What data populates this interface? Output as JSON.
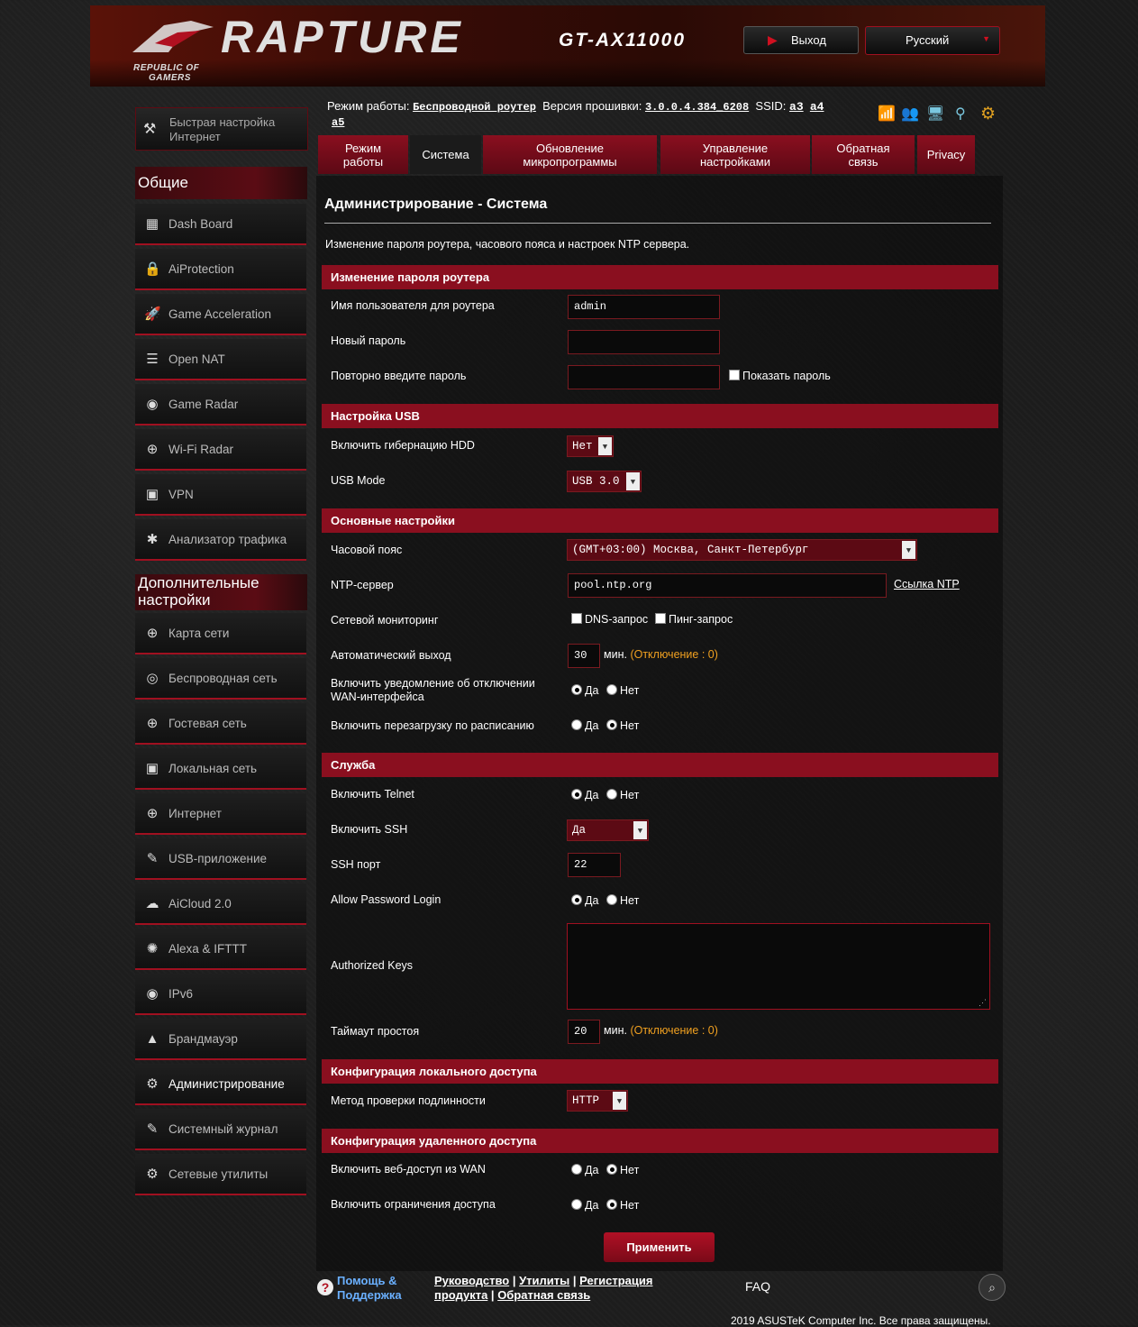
{
  "header": {
    "logo_line1": "REPUBLIC OF",
    "logo_line2": "GAMERS",
    "brand": "RAPTURE",
    "model": "GT-AX11000",
    "logout_label": "Выход",
    "language": "Русский"
  },
  "status": {
    "mode_label": "Режим работы:",
    "mode_value": "Беспроводной роутер",
    "fw_label": "Версия прошивки:",
    "fw_value": "3.0.0.4.384_6208",
    "ssid_label": "SSID:",
    "ssid1": "a3",
    "ssid2": "a4",
    "ssid3": "a5"
  },
  "sidebar": {
    "quick_setup": "Быстрая настройка Интернет",
    "general_title": "Общие",
    "general": [
      {
        "label": "Dash Board",
        "icon": "▦"
      },
      {
        "label": "AiProtection",
        "icon": "🔒"
      },
      {
        "label": "Game Acceleration",
        "icon": "🚀"
      },
      {
        "label": "Open NAT",
        "icon": "☰"
      },
      {
        "label": "Game Radar",
        "icon": "◉"
      },
      {
        "label": "Wi-Fi Radar",
        "icon": "⊕"
      },
      {
        "label": "VPN",
        "icon": "▣"
      },
      {
        "label": "Анализатор трафика",
        "icon": "✱"
      }
    ],
    "advanced_title": "Дополнительные настройки",
    "advanced": [
      {
        "label": "Карта сети",
        "icon": "⊕"
      },
      {
        "label": "Беспроводная сеть",
        "icon": "◎"
      },
      {
        "label": "Гостевая сеть",
        "icon": "⊕"
      },
      {
        "label": "Локальная сеть",
        "icon": "▣"
      },
      {
        "label": "Интернет",
        "icon": "⊕"
      },
      {
        "label": "USB-приложение",
        "icon": "✎"
      },
      {
        "label": "AiCloud 2.0",
        "icon": "☁"
      },
      {
        "label": "Alexa & IFTTT",
        "icon": "✺"
      },
      {
        "label": "IPv6",
        "icon": "◉"
      },
      {
        "label": "Брандмауэр",
        "icon": "▲"
      },
      {
        "label": "Администрирование",
        "icon": "⚙"
      },
      {
        "label": "Системный журнал",
        "icon": "✎"
      },
      {
        "label": "Сетевые утилиты",
        "icon": "⚙"
      }
    ]
  },
  "tabs": [
    {
      "label": "Режим работы"
    },
    {
      "label": "Система"
    },
    {
      "label": "Обновление микропрограммы"
    },
    {
      "label": "Управление настройками"
    },
    {
      "label": "Обратная связь"
    },
    {
      "label": "Privacy"
    }
  ],
  "page": {
    "title": "Администрирование - Система",
    "description": "Изменение пароля роутера, часового пояса и настроек NTP сервера."
  },
  "sections": {
    "password": "Изменение пароля роутера",
    "usb": "Настройка USB",
    "basic": "Основные настройки",
    "service": "Служба",
    "local_access": "Конфигурация локального доступа",
    "remote_access": "Конфигурация удаленного доступа"
  },
  "form": {
    "username_label": "Имя пользователя для роутера",
    "username_value": "admin",
    "new_password_label": "Новый пароль",
    "retype_password_label": "Повторно введите пароль",
    "show_password_label": "Показать пароль",
    "hdd_hibernation_label": "Включить гибернацию HDD",
    "hdd_hibernation_value": "Нет",
    "usb_mode_label": "USB Mode",
    "usb_mode_value": "USB 3.0",
    "timezone_label": "Часовой пояс",
    "timezone_value": "(GMT+03:00) Москва, Санкт-Петербург",
    "ntp_label": "NTP-сервер",
    "ntp_value": "pool.ntp.org",
    "ntp_link": "Ссылка NTP",
    "monitoring_label": "Сетевой мониторинг",
    "dns_query": "DNS-запрос",
    "ping_query": "Пинг-запрос",
    "autologout_label": "Автоматический выход",
    "autologout_value": "30",
    "minutes": "мин.",
    "disable_hint": "(Отключение : 0)",
    "wan_notify_label": "Включить уведомление об отключении WAN-интерфейса",
    "reboot_schedule_label": "Включить перезагрузку по расписанию",
    "telnet_label": "Включить Telnet",
    "ssh_label": "Включить SSH",
    "ssh_value": "Да",
    "ssh_port_label": "SSH порт",
    "ssh_port_value": "22",
    "allow_password_label": "Allow Password Login",
    "authorized_keys_label": "Authorized Keys",
    "idle_timeout_label": "Таймаут простоя",
    "idle_timeout_value": "20",
    "auth_method_label": "Метод проверки подлинности",
    "auth_method_value": "HTTP",
    "wan_web_label": "Включить веб-доступ из WAN",
    "access_restrict_label": "Включить ограничения доступа",
    "yes": "Да",
    "no": "Нет",
    "apply_button": "Применить"
  },
  "footer": {
    "help_line1": "Помощь &",
    "help_line2": "Поддержка",
    "manual": "Руководство",
    "utilities": "Утилиты",
    "registration": "Регистрация",
    "product": "продукта",
    "feedback": "Обратная связь",
    "faq": "FAQ",
    "copyright": "2019 ASUSTeK Computer Inc. Все права защищены."
  },
  "colors": {
    "accent": "#8a0f1f",
    "hint": "#f0a020",
    "background": "#1a1a1a"
  }
}
